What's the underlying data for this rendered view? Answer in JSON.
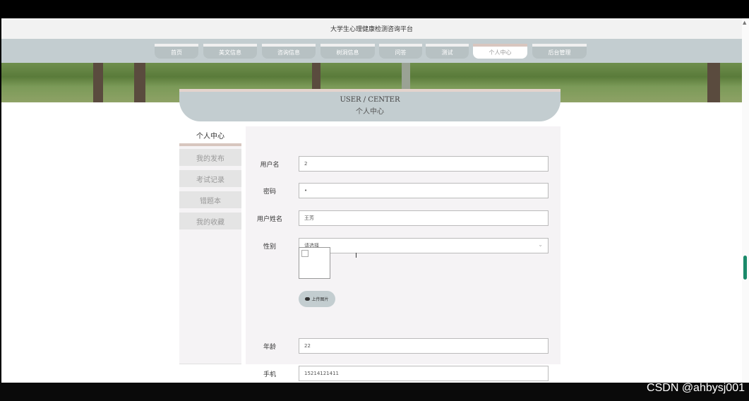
{
  "header": {
    "title": "大学生心理健康检测咨询平台"
  },
  "nav": {
    "items": [
      {
        "label": "首页"
      },
      {
        "label": "美文信息"
      },
      {
        "label": "咨询信息"
      },
      {
        "label": "树洞信息"
      },
      {
        "label": "问答"
      },
      {
        "label": "测试"
      },
      {
        "label": "个人中心"
      },
      {
        "label": "后台管理"
      }
    ],
    "active": "个人中心"
  },
  "user_center": {
    "title_en": "USER / CENTER",
    "title_cn": "个人中心"
  },
  "sidebar": {
    "title": "个人中心",
    "items": [
      {
        "label": "我的发布"
      },
      {
        "label": "考试记录"
      },
      {
        "label": "错题本"
      },
      {
        "label": "我的收藏"
      }
    ]
  },
  "form": {
    "username": {
      "label": "用户名",
      "value": "2"
    },
    "password": {
      "label": "密码",
      "value": "•"
    },
    "realname": {
      "label": "用户姓名",
      "value": "王芳"
    },
    "gender": {
      "label": "性别",
      "placeholder": "请选择"
    },
    "upload_label": "上传图片",
    "age": {
      "label": "年龄",
      "value": "22"
    },
    "phone": {
      "label": "手机",
      "value": "15214121411"
    }
  },
  "watermark": "CSDN @ahbysj001",
  "colors": {
    "accent": "#c3cdd0",
    "tab_border": "#d8c6bf",
    "scroll_thumb": "#1a8a6a"
  },
  "icons": {
    "upload": "cloud-upload-icon",
    "select": "chevron-down-icon"
  }
}
